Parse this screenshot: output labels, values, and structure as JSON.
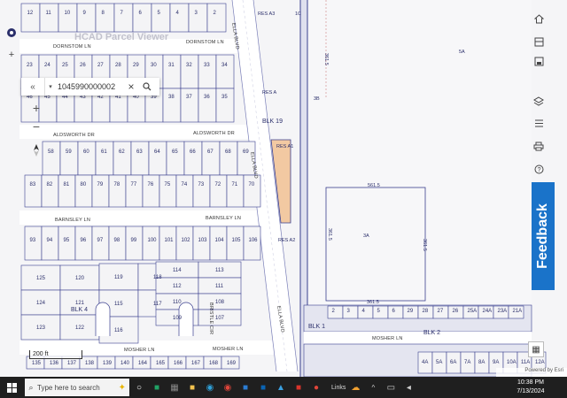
{
  "app": {
    "title": "HCAD Parcel Viewer"
  },
  "search": {
    "value": "1045990000002",
    "collapse_icon": "chevron-double-left-icon",
    "source_icon": "triangle-down-icon",
    "clear_icon": "close-icon",
    "search_icon": "search-icon"
  },
  "map": {
    "streets": {
      "dornstom": "DORNSTOM LN",
      "aldsworth": "ALDSWORTH DR",
      "barnsley": "BARNSLEY LN",
      "mosher": "MOSHER LN",
      "ella": "ELLA BLVD",
      "ella_alt": "ELLA BLVD",
      "bristle": "BRISTLE CIR",
      "mosher_east": "MOSHER LN"
    },
    "block_labels": {
      "blk19": "BLK 19",
      "blk4": "BLK 4",
      "blk1": "BLK 1",
      "blk2": "BLK 2"
    },
    "reserve_labels": {
      "res_a3": "RES A3",
      "res_a": "RES A",
      "res_a1": "RES A1",
      "res_a2": "RES A2"
    },
    "area_labels": {
      "lot_5a": "5A",
      "lot_3b": "3B",
      "lot_3a": "3A",
      "tract_1c": "1C",
      "dim_361a": "361.5",
      "dim_361b": "361.5",
      "dim_361c": "361.5",
      "dim_361d": "361.5",
      "dim_top": "561.5"
    },
    "highlighted_parcel_color": "#f2c9a2",
    "parcel_line_color": "#3a3f8f",
    "lot_rows": {
      "row_top": [
        "12",
        "11",
        "10",
        "9",
        "8",
        "7",
        "6",
        "5",
        "4",
        "3",
        "2"
      ],
      "row_a": [
        "23",
        "24",
        "25",
        "26",
        "27",
        "28",
        "29",
        "30",
        "31",
        "32",
        "33",
        "34"
      ],
      "row_b": [
        "46",
        "45",
        "44",
        "43",
        "42",
        "41",
        "40",
        "39",
        "38",
        "37",
        "36",
        "35"
      ],
      "row_c": [
        "58",
        "59",
        "60",
        "61",
        "62",
        "63",
        "64",
        "65",
        "66",
        "67",
        "68",
        "69"
      ],
      "row_d": [
        "83",
        "82",
        "81",
        "80",
        "79",
        "78",
        "77",
        "76",
        "75",
        "74",
        "73",
        "72",
        "71",
        "70"
      ],
      "row_e": [
        "93",
        "94",
        "95",
        "96",
        "97",
        "98",
        "99",
        "100",
        "101",
        "102",
        "103",
        "104",
        "105",
        "106"
      ],
      "cul_left": [
        "125",
        "120",
        "124",
        "121",
        "123",
        "122"
      ],
      "cul_mid": [
        "119",
        "118",
        "115",
        "117",
        "116"
      ],
      "cul_right": [
        "114",
        "113",
        "112",
        "111",
        "110",
        "108",
        "109",
        "107"
      ],
      "row_bottom": [
        "135",
        "136",
        "137",
        "138",
        "139",
        "140",
        "164",
        "165",
        "166",
        "167",
        "168",
        "169"
      ],
      "east_row": [
        "2",
        "3",
        "4",
        "5",
        "6",
        "29",
        "28",
        "27",
        "26",
        "25A",
        "24A",
        "23A",
        "21A"
      ],
      "east_bottom": [
        "4A",
        "5A",
        "6A",
        "7A",
        "8A",
        "9A",
        "10A",
        "11A",
        "12A"
      ]
    }
  },
  "left_tools": {
    "home_icon": "target-icon",
    "add_icon": "plus-icon",
    "zoom_in": "+",
    "zoom_out": "−",
    "compass_icon": "compass-icon"
  },
  "right_tools": {
    "items": [
      "home-icon",
      "basemap-icon",
      "print-layout-icon",
      "layers-icon",
      "list-icon",
      "printer-icon",
      "help-icon"
    ]
  },
  "feedback": {
    "label": "Feedback"
  },
  "scalebar": {
    "label": "200 ft"
  },
  "attribution": {
    "label": "Powered by Esri"
  },
  "taskbar": {
    "search_placeholder": "Type here to search",
    "links_label": "Links",
    "time": "10:38 PM",
    "date": "7/13/2024"
  }
}
